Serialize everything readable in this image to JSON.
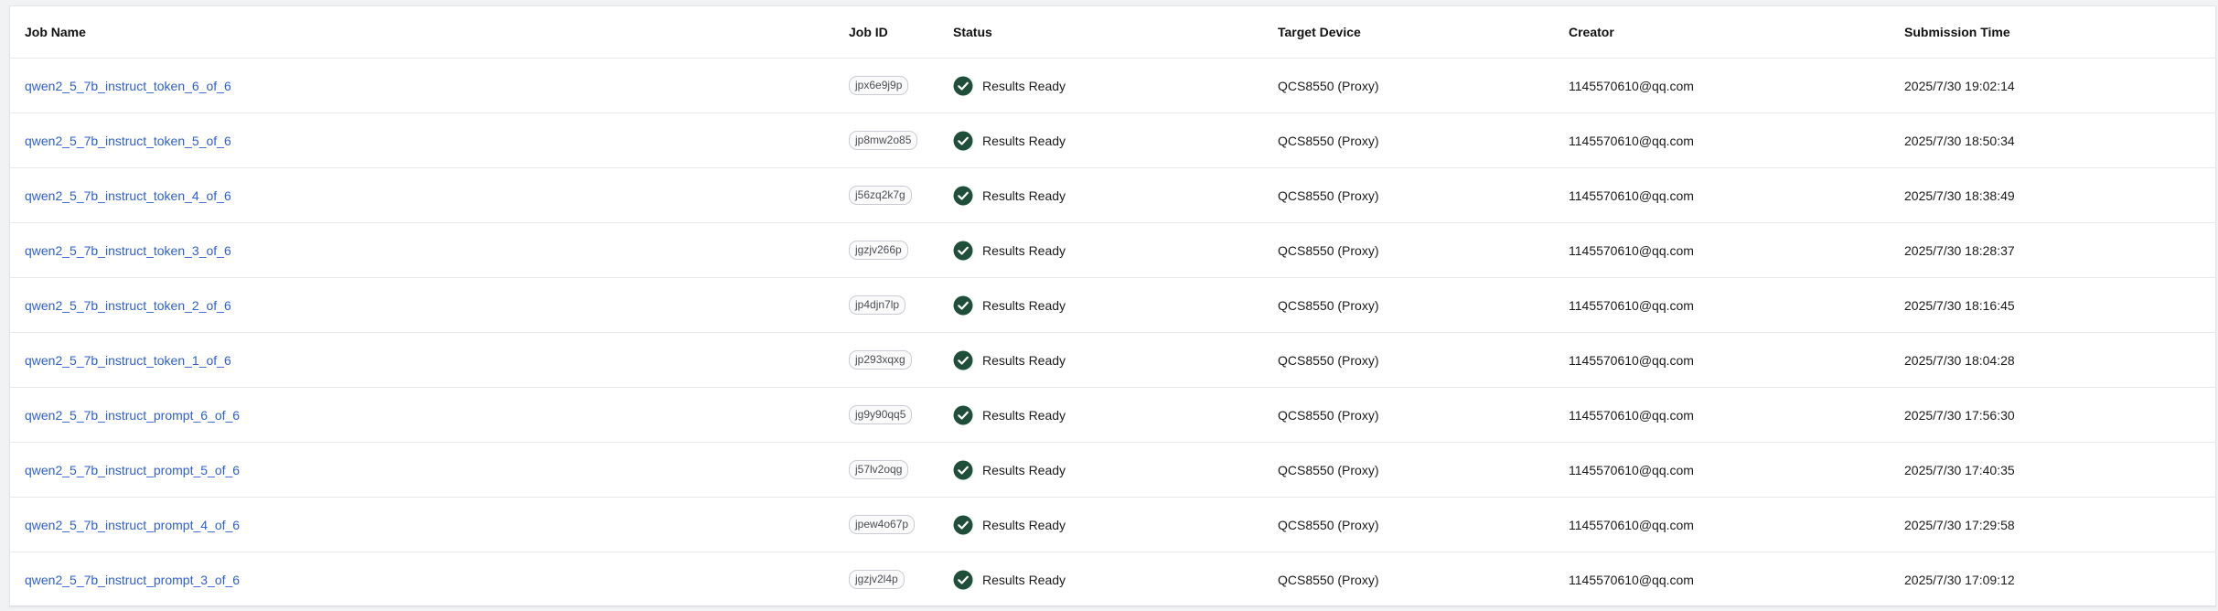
{
  "table": {
    "columns": [
      "Job Name",
      "Job ID",
      "Status",
      "Target Device",
      "Creator",
      "Submission Time"
    ],
    "status_color": "#1f4f3a",
    "link_color": "#2f5fd0",
    "rows": [
      {
        "job_name": "qwen2_5_7b_instruct_token_6_of_6",
        "job_id": "jpx6e9j9p",
        "status": "Results Ready",
        "device": "QCS8550 (Proxy)",
        "creator": "1145570610@qq.com",
        "time": "2025/7/30 19:02:14"
      },
      {
        "job_name": "qwen2_5_7b_instruct_token_5_of_6",
        "job_id": "jp8mw2o85",
        "status": "Results Ready",
        "device": "QCS8550 (Proxy)",
        "creator": "1145570610@qq.com",
        "time": "2025/7/30 18:50:34"
      },
      {
        "job_name": "qwen2_5_7b_instruct_token_4_of_6",
        "job_id": "j56zq2k7g",
        "status": "Results Ready",
        "device": "QCS8550 (Proxy)",
        "creator": "1145570610@qq.com",
        "time": "2025/7/30 18:38:49"
      },
      {
        "job_name": "qwen2_5_7b_instruct_token_3_of_6",
        "job_id": "jgzjv266p",
        "status": "Results Ready",
        "device": "QCS8550 (Proxy)",
        "creator": "1145570610@qq.com",
        "time": "2025/7/30 18:28:37"
      },
      {
        "job_name": "qwen2_5_7b_instruct_token_2_of_6",
        "job_id": "jp4djn7lp",
        "status": "Results Ready",
        "device": "QCS8550 (Proxy)",
        "creator": "1145570610@qq.com",
        "time": "2025/7/30 18:16:45"
      },
      {
        "job_name": "qwen2_5_7b_instruct_token_1_of_6",
        "job_id": "jp293xqxg",
        "status": "Results Ready",
        "device": "QCS8550 (Proxy)",
        "creator": "1145570610@qq.com",
        "time": "2025/7/30 18:04:28"
      },
      {
        "job_name": "qwen2_5_7b_instruct_prompt_6_of_6",
        "job_id": "jg9y90qq5",
        "status": "Results Ready",
        "device": "QCS8550 (Proxy)",
        "creator": "1145570610@qq.com",
        "time": "2025/7/30 17:56:30"
      },
      {
        "job_name": "qwen2_5_7b_instruct_prompt_5_of_6",
        "job_id": "j57lv2oqg",
        "status": "Results Ready",
        "device": "QCS8550 (Proxy)",
        "creator": "1145570610@qq.com",
        "time": "2025/7/30 17:40:35"
      },
      {
        "job_name": "qwen2_5_7b_instruct_prompt_4_of_6",
        "job_id": "jpew4o67p",
        "status": "Results Ready",
        "device": "QCS8550 (Proxy)",
        "creator": "1145570610@qq.com",
        "time": "2025/7/30 17:29:58"
      },
      {
        "job_name": "qwen2_5_7b_instruct_prompt_3_of_6",
        "job_id": "jgzjv2l4p",
        "status": "Results Ready",
        "device": "QCS8550 (Proxy)",
        "creator": "1145570610@qq.com",
        "time": "2025/7/30 17:09:12"
      }
    ]
  }
}
